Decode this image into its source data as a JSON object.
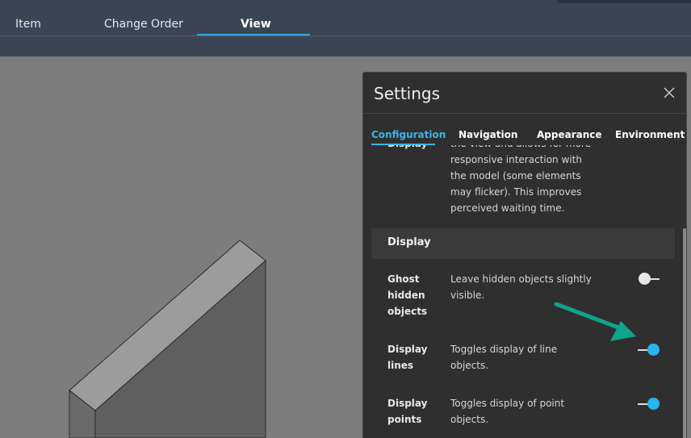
{
  "topbar": {
    "tabs": [
      {
        "label": "Item"
      },
      {
        "label": "Change Order"
      },
      {
        "label": "View"
      }
    ],
    "active_tab": "View"
  },
  "settings": {
    "title": "Settings",
    "tabs": [
      {
        "label": "Configuration"
      },
      {
        "label": "Navigation"
      },
      {
        "label": "Appearance"
      },
      {
        "label": "Environment"
      }
    ],
    "active_tab": "Configuration",
    "partial_top": {
      "label": "Display",
      "desc_cut": "the view and allows for more",
      "desc_lines": [
        "responsive interaction with",
        "the model (some elements",
        "may flicker). This improves",
        "perceived waiting time."
      ]
    },
    "section": {
      "title": "Display"
    },
    "rows": [
      {
        "label_lines": [
          "Ghost",
          "hidden",
          "objects"
        ],
        "desc_lines": [
          "Leave hidden objects slightly",
          "visible."
        ],
        "enabled": false
      },
      {
        "label_lines": [
          "Display",
          "lines"
        ],
        "desc_lines": [
          "Toggles display of line",
          "objects."
        ],
        "enabled": true
      },
      {
        "label_lines": [
          "Display",
          "points"
        ],
        "desc_lines": [
          "Toggles display of point",
          "objects."
        ],
        "enabled": true
      }
    ]
  },
  "colors": {
    "accent": "#3cb5e8",
    "annotation_arrow": "#0fa58a",
    "toggle_on": "#2ab4ec",
    "toggle_off": "#e0e0e0"
  }
}
